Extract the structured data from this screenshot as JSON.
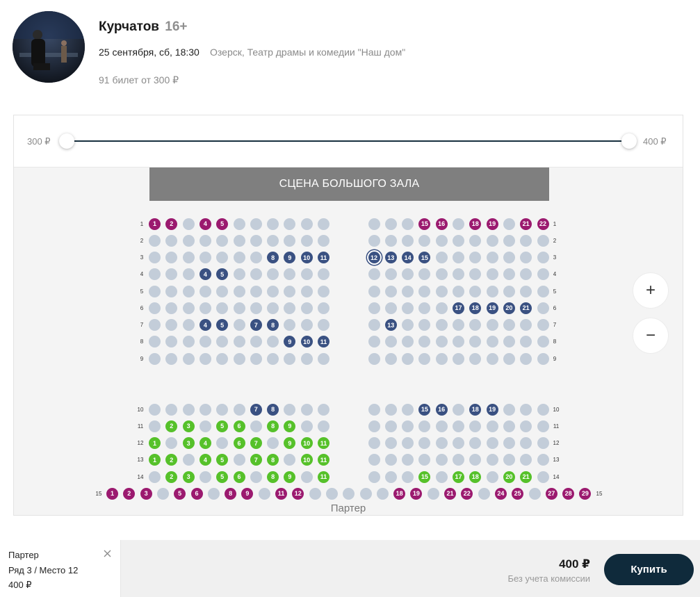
{
  "event": {
    "title": "Курчатов",
    "age": "16+",
    "datetime": "25 сентября, сб, 18:30",
    "venue": "Озерск, Театр драмы и комедии \"Наш дом\"",
    "tickets_info": "91 билет от 300 ₽"
  },
  "price_filter": {
    "min_label": "300 ₽",
    "max_label": "400 ₽"
  },
  "stage_label": "СЦЕНА БОЛЬШОГО ЗАЛА",
  "section_name": "Партер",
  "zoom": {
    "in": "+",
    "out": "−"
  },
  "seat_colors": {
    "unavailable": "#c3cdd9",
    "magenta": "#9b1a6f",
    "navy": "#3a5182",
    "green": "#56c12a"
  },
  "seat_map": {
    "upper_left": [
      {
        "row": 1,
        "seats": {
          "1": "magenta",
          "2": "magenta",
          "4": "magenta",
          "5": "magenta"
        }
      },
      {
        "row": 2,
        "seats": {}
      },
      {
        "row": 3,
        "seats": {
          "8": "navy",
          "9": "navy",
          "10": "navy",
          "11": "navy"
        }
      },
      {
        "row": 4,
        "seats": {
          "4": "navy",
          "5": "navy"
        }
      },
      {
        "row": 5,
        "seats": {}
      },
      {
        "row": 6,
        "seats": {}
      },
      {
        "row": 7,
        "seats": {
          "4": "navy",
          "5": "navy",
          "7": "navy",
          "8": "navy"
        }
      },
      {
        "row": 8,
        "seats": {
          "9": "navy",
          "10": "navy",
          "11": "navy"
        }
      },
      {
        "row": 9,
        "seats": {}
      }
    ],
    "upper_right": [
      {
        "row": 1,
        "seats": {
          "15": "magenta",
          "16": "magenta",
          "18": "magenta",
          "19": "magenta",
          "21": "magenta",
          "22": "magenta"
        }
      },
      {
        "row": 2,
        "seats": {}
      },
      {
        "row": 3,
        "seats": {
          "12": "navy",
          "13": "navy",
          "14": "navy",
          "15": "navy"
        }
      },
      {
        "row": 4,
        "seats": {}
      },
      {
        "row": 5,
        "seats": {}
      },
      {
        "row": 6,
        "seats": {
          "17": "navy",
          "18": "navy",
          "19": "navy",
          "20": "navy",
          "21": "navy"
        }
      },
      {
        "row": 7,
        "seats": {
          "13": "navy"
        }
      },
      {
        "row": 8,
        "seats": {}
      },
      {
        "row": 9,
        "seats": {}
      }
    ],
    "lower_left": [
      {
        "row": 10,
        "seats": {
          "7": "navy",
          "8": "navy"
        }
      },
      {
        "row": 11,
        "seats": {
          "2": "green",
          "3": "green",
          "5": "green",
          "6": "green",
          "8": "green",
          "9": "green"
        }
      },
      {
        "row": 12,
        "seats": {
          "1": "green",
          "3": "green",
          "4": "green",
          "6": "green",
          "7": "green",
          "9": "green",
          "10": "green",
          "11": "green"
        }
      },
      {
        "row": 13,
        "seats": {
          "1": "green",
          "2": "green",
          "4": "green",
          "5": "green",
          "7": "green",
          "8": "green",
          "10": "green",
          "11": "green"
        }
      },
      {
        "row": 14,
        "seats": {
          "2": "green",
          "3": "green",
          "5": "green",
          "6": "green",
          "8": "green",
          "9": "green",
          "11": "green"
        }
      }
    ],
    "lower_right": [
      {
        "row": 10,
        "seats": {
          "15": "navy",
          "16": "navy",
          "18": "navy",
          "19": "navy"
        }
      },
      {
        "row": 11,
        "seats": {}
      },
      {
        "row": 12,
        "seats": {}
      },
      {
        "row": 13,
        "seats": {}
      },
      {
        "row": 14,
        "seats": {
          "15": "green",
          "17": "green",
          "18": "green",
          "20": "green",
          "21": "green"
        }
      }
    ],
    "row_15": {
      "row": 15,
      "seats": {
        "1": "magenta",
        "2": "magenta",
        "3": "magenta",
        "5": "magenta",
        "6": "magenta",
        "8": "magenta",
        "9": "magenta",
        "11": "magenta",
        "12": "magenta",
        "18": "magenta",
        "19": "magenta",
        "21": "magenta",
        "22": "magenta",
        "24": "magenta",
        "25": "magenta",
        "27": "magenta",
        "28": "magenta",
        "29": "magenta"
      }
    },
    "selected": {
      "row": 3,
      "seat": 12
    }
  },
  "cart": {
    "section": "Партер",
    "row_seat": "Ряд 3 / Место 12",
    "price": "400 ₽",
    "total": "400 ₽",
    "commission_note": "Без учета комиссии",
    "buy_label": "Купить"
  }
}
